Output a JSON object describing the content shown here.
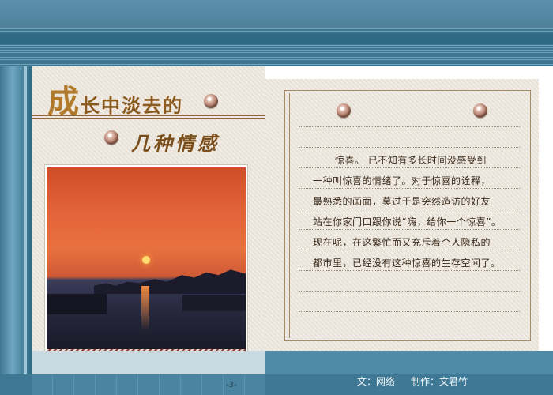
{
  "title": {
    "first_char": "成",
    "rest_line1": "长中淡去的",
    "line2": "几种情感"
  },
  "poem": {
    "lines": [
      "惊喜。  已不知有多长时间没感受到",
      "一种叫惊喜的情绪了。对于惊喜的诠释，",
      "最熟悉的画面，莫过于是突然造访的好友",
      "站在你家门口跟你说“嗨，给你一个惊喜”。",
      "现在呢，在这繁忙而又充斥着个人隐私的",
      "都市里，已经没有这种惊喜的生存空间了。"
    ]
  },
  "footer": {
    "source": "文：网络",
    "credit": "制作：文君竹",
    "page_number": "-3-"
  },
  "photo": {
    "subject": "sunset-harbor-photo"
  },
  "colors": {
    "frame_blue": "#4f8aa8",
    "paper": "#ece6dc",
    "title_brown": "#8b5a1e"
  }
}
